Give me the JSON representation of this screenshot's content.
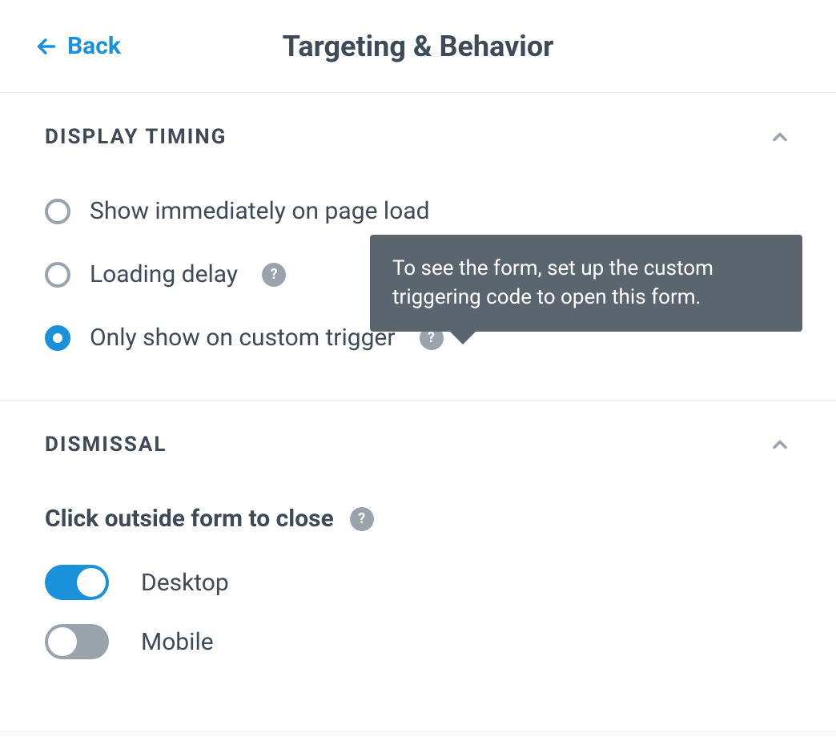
{
  "colors": {
    "accent": "#1a91d8",
    "muted": "#9aa2ab",
    "text": "#3e4a57",
    "tooltip_bg": "#5a6570"
  },
  "header": {
    "back_label": "Back",
    "title": "Targeting & Behavior"
  },
  "display_timing": {
    "section_title": "Display Timing",
    "expanded": true,
    "selected_index": 2,
    "options": [
      {
        "label": "Show immediately on page load",
        "has_help": false
      },
      {
        "label": "Loading delay",
        "has_help": true
      },
      {
        "label": "Only show on custom trigger",
        "has_help": true
      }
    ],
    "tooltip_text": "To see the form, set up the custom triggering code to open this form."
  },
  "dismissal": {
    "section_title": "Dismissal",
    "expanded": true,
    "click_outside": {
      "label": "Click outside form to close",
      "has_help": true,
      "toggles": [
        {
          "name": "Desktop",
          "on": true
        },
        {
          "name": "Mobile",
          "on": false
        }
      ]
    }
  }
}
